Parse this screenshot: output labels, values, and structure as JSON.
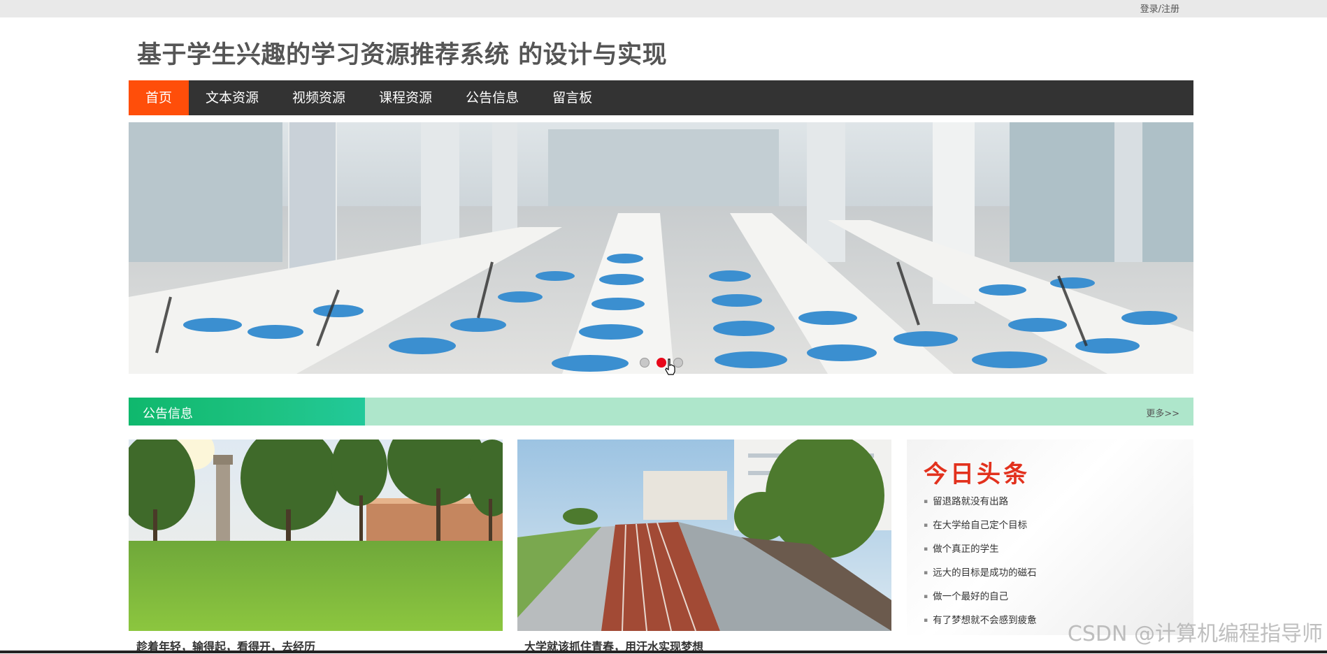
{
  "header": {
    "login_label": "登录/注册",
    "site_title": "基于学生兴趣的学习资源推荐系统 的设计与实现"
  },
  "nav": {
    "items": [
      {
        "label": "首页",
        "active": true
      },
      {
        "label": "文本资源",
        "active": false
      },
      {
        "label": "视频资源",
        "active": false
      },
      {
        "label": "课程资源",
        "active": false
      },
      {
        "label": "公告信息",
        "active": false
      },
      {
        "label": "留言板",
        "active": false
      }
    ]
  },
  "carousel": {
    "slide_count": 3,
    "active_index": 1
  },
  "notice_section": {
    "title": "公告信息",
    "more_label": "更多>>"
  },
  "cards": [
    {
      "caption": "趁着年轻，输得起，看得开，去经历"
    },
    {
      "caption": "大学就该抓住青春，用汗水实现梦想"
    }
  ],
  "headlines": {
    "title": "今日头条",
    "items": [
      "留退路就没有出路",
      "在大学给自己定个目标",
      "做个真正的学生",
      "远大的目标是成功的磁石",
      "做一个最好的自己",
      "有了梦想就不会感到疲惫"
    ]
  },
  "watermark": "CSDN @计算机编程指导师",
  "colors": {
    "nav_bg": "#333333",
    "nav_active": "#ff4e0a",
    "section_green": "#1ec282",
    "section_light": "#aee6cb",
    "headline_red": "#e2311d",
    "dot_active": "#e8081a"
  }
}
